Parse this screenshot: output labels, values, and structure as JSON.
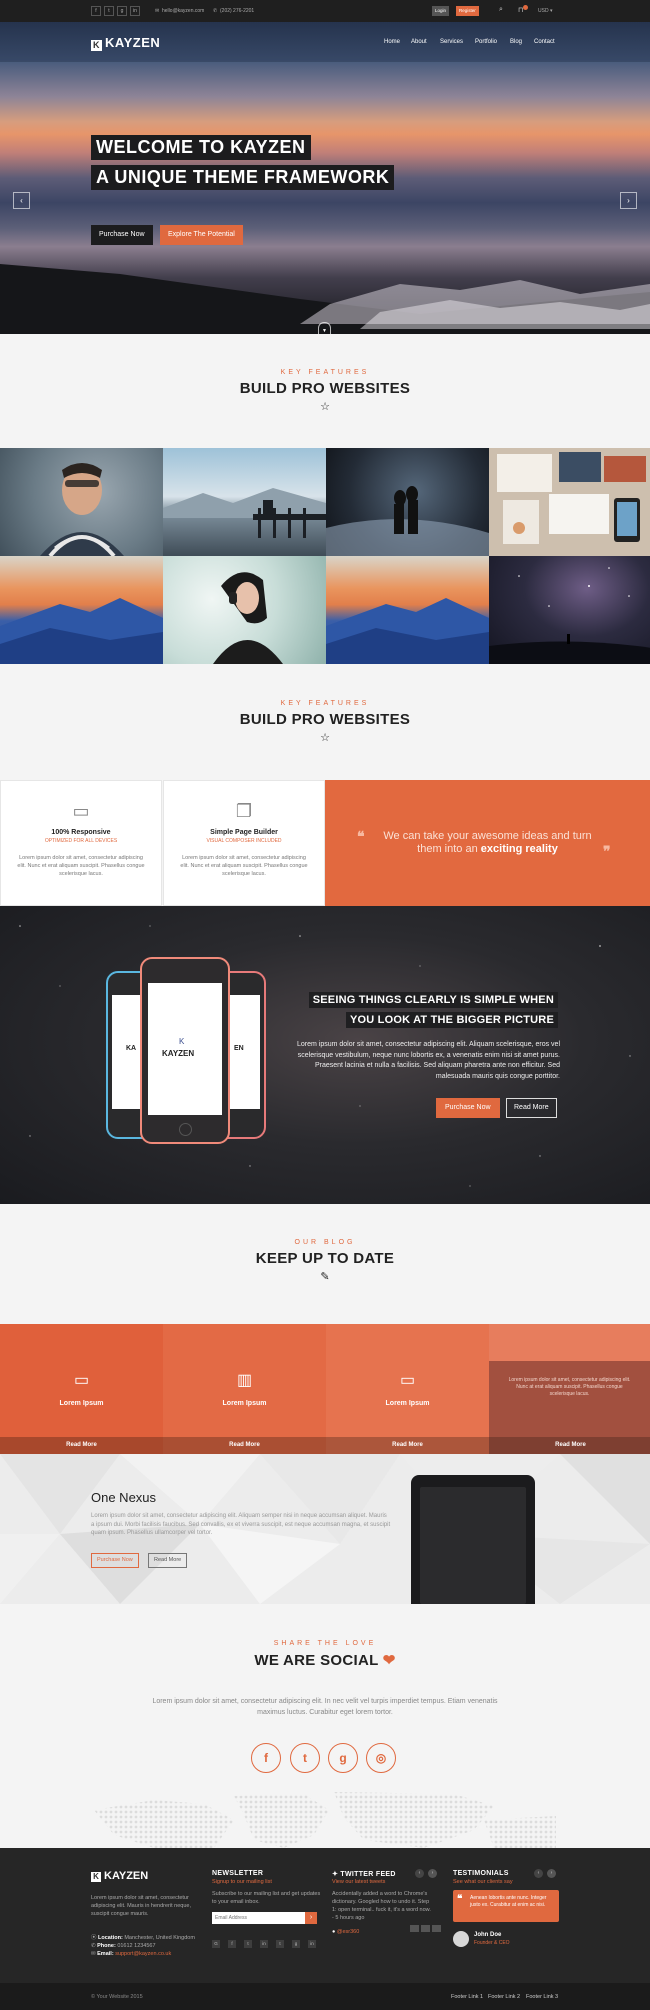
{
  "topbar": {
    "social": [
      "f",
      "t",
      "g",
      "in"
    ],
    "email": "hello@kayzen.com",
    "phone": "(202) 276-2201",
    "login_label": "Login",
    "register_label": "Register",
    "search_glyph": "⌕",
    "cart_glyph": "⊓",
    "currency": "USD ▾"
  },
  "brand": {
    "name": "KAYZEN",
    "mark": "K"
  },
  "nav": [
    "Home",
    "About",
    "Services",
    "Portfolio",
    "Blog",
    "Contact"
  ],
  "hero": {
    "line1": "WELCOME TO KAYZEN",
    "line2": "A UNIQUE THEME FRAMEWORK",
    "btn_primary": "Purchase Now",
    "btn_secondary": "Explore The Potential",
    "prev": "‹",
    "next": "›",
    "scroll": "▼"
  },
  "features_head": {
    "eyebrow": "KEY FEATURES",
    "title": "BUILD PRO WEBSITES",
    "ornament": "☆"
  },
  "features_head2": {
    "eyebrow": "KEY FEATURES",
    "title": "BUILD PRO WEBSITES",
    "ornament": "☆"
  },
  "features": [
    {
      "icon": "monitor-icon",
      "glyph": "▭",
      "title": "100% Responsive",
      "subtitle": "OPTIMIZED FOR ALL DEVICES",
      "text": "Lorem ipsum dolor sit amet, consectetur adipiscing elit. Nunc et erat aliquam suscipit. Phasellus congue scelerisque lacus."
    },
    {
      "icon": "pages-icon",
      "glyph": "❐",
      "title": "Simple Page Builder",
      "subtitle": "VISUAL COMPOSER INCLUDED",
      "text": "Lorem ipsum dolor sit amet, consectetur adipiscing elit. Nunc et erat aliquam suscipit. Phasellus congue scelerisque lacus."
    }
  ],
  "quote": {
    "text": "We can take your awesome ideas and turn them into an",
    "bold": "exciting reality",
    "open": "❝",
    "close": "❞"
  },
  "showcase": {
    "heading1": "SEEING THINGS CLEARLY IS SIMPLE WHEN",
    "heading2": "YOU LOOK AT THE BIGGER PICTURE",
    "text": "Lorem ipsum dolor sit amet, consectetur adipiscing elit. Aliquam scelerisque, eros vel scelerisque vestibulum, neque nunc lobortis ex, a venenatis enim nisi sit amet purus. Praesent lacinia et nulla a facilisis. Sed aliquam pharetra ante non efficitur. Sed malesuada mauris quis congue porttitor.",
    "btn_primary": "Purchase Now",
    "btn_secondary": "Read More",
    "phone_logo": "KAYZEN",
    "phone_logo_left": "KA",
    "phone_logo_right": "EN"
  },
  "blog_head": {
    "eyebrow": "OUR BLOG",
    "title": "KEEP UP TO DATE",
    "ornament": "✎"
  },
  "blog": [
    {
      "icon": "battery-icon",
      "glyph": "▭",
      "title": "Lorem Ipsum",
      "read": "Read More",
      "color": "#e0603b"
    },
    {
      "icon": "chart-icon",
      "glyph": "▥",
      "title": "Lorem Ipsum",
      "read": "Read More",
      "color": "#e36a45"
    },
    {
      "icon": "monitor-icon",
      "glyph": "▭",
      "title": "Lorem Ipsum",
      "read": "Read More",
      "color": "#e6734f"
    },
    {
      "icon": "",
      "glyph": "",
      "title": "",
      "text": "Lorem ipsum dolor sit amet, consectetur adipiscing elit. Nunc at erat aliquam suscipit. Phasellus congue scelerisque lacus.",
      "read": "Read More",
      "color": "#a2503f"
    }
  ],
  "nexus": {
    "title": "One Nexus",
    "text": "Lorem ipsum dolor sit amet, consectetur adipiscing elit. Aliquam semper nisi in neque accumsan aliquet. Mauris a ipsum dui. Morbi facilisis faucibus. Sed convallis, ex et viverra suscipit, est neque accumsan magna, et suscipit quam ipsum. Phasellus ullamcorper vel tortor.",
    "btn_primary": "Purchase Now",
    "btn_secondary": "Read More"
  },
  "social_head": {
    "eyebrow": "SHARE THE LOVE",
    "title": "WE ARE SOCIAL",
    "heart": "❤"
  },
  "social": {
    "text": "Lorem ipsum dolor sit amet, consectetur adipiscing elit. In nec velit vel turpis imperdiet tempus. Etiam venenatis maximus luctus. Curabitur eget lorem tortor.",
    "icons": [
      {
        "name": "facebook-icon",
        "glyph": "f"
      },
      {
        "name": "twitter-icon",
        "glyph": "t"
      },
      {
        "name": "github-icon",
        "glyph": "g"
      },
      {
        "name": "dribbble-icon",
        "glyph": "◎"
      }
    ]
  },
  "footer": {
    "about": "Lorem ipsum dolor sit amet, consectetur adipiscing elit. Mauris in hendrerit neque, suscipit congue mauris.",
    "location_label": "Location:",
    "location": "Manchester, United Kingdom",
    "phone_label": "Phone:",
    "phone": "01612 1234567",
    "email_label": "Email:",
    "email": "support@kayzen.co.uk",
    "newsletter_title": "NEWSLETTER",
    "newsletter_sub": "Signup to our mailing list",
    "newsletter_text": "Subscribe to our mailing list and get updates to your email inbox.",
    "newsletter_placeholder": "Email Address",
    "newsletter_go": "›",
    "newsletter_social": [
      "G",
      "f",
      "t",
      "in",
      "t",
      "g",
      "in"
    ],
    "twitter_title": "TWITTER FEED",
    "twitter_sub": "View our latest tweets",
    "tweet": "Accidentally added a word to Chrome's dictionary. Googled how to undo it. Step 1: open terminal.. fuck it, it's a word now. - 5 hours ago",
    "tweet_handle": "@esr360",
    "testimonials_title": "TESTIMONIALS",
    "testimonials_sub": "See what our clients say",
    "testimonial": "Aenean lobortis ante nunc. Integer justo ex. Curabitur at enim ac nisi.",
    "testimonial_name": "John Doe",
    "testimonial_role": "Founder & CEO"
  },
  "bottombar": {
    "copyright": "© Your Website 2015",
    "links": [
      "Footer Link 1",
      "Footer Link 2",
      "Footer Link 3"
    ]
  }
}
